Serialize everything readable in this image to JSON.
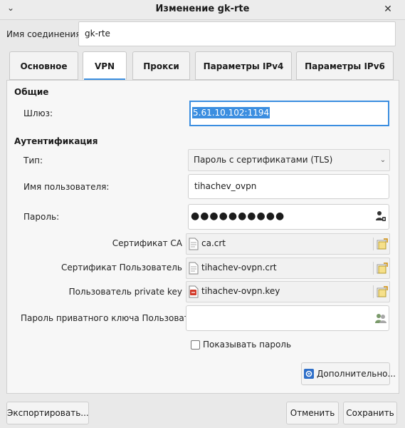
{
  "window": {
    "title": "Изменение gk-rte",
    "chevron_icon": "chevron-down",
    "close_icon": "close"
  },
  "connection": {
    "name_label": "Имя соединения",
    "name_value": "gk-rte"
  },
  "tabs": [
    {
      "label": "Основное",
      "active": false
    },
    {
      "label": "VPN",
      "active": true
    },
    {
      "label": "Прокси",
      "active": false
    },
    {
      "label": "Параметры IPv4",
      "active": false
    },
    {
      "label": "Параметры IPv6",
      "active": false
    }
  ],
  "general": {
    "section_title": "Общие",
    "gateway_label": "Шлюз:",
    "gateway_value": "5.61.10.102:1194"
  },
  "auth": {
    "section_title": "Аутентификация",
    "type_label": "Тип:",
    "type_value": "Пароль с сертификатами (TLS)",
    "username_label": "Имя пользователя:",
    "username_value": "tihachev_ovpn",
    "password_label": "Пароль:",
    "password_value": "●●●●●●●●●●",
    "ca_label": "Сертификат CA",
    "ca_value": "ca.crt",
    "user_cert_label": "Сертификат Пользователь",
    "user_cert_value": "tihachev-ovpn.crt",
    "private_key_label": "Пользователь private key",
    "private_key_value": "tihachev-ovpn.key",
    "key_password_label": "Пароль приватного ключа Пользователь",
    "key_password_value": "",
    "show_password_label": "Показывать пароль",
    "show_password_checked": false
  },
  "buttons": {
    "advanced": "Дополнительно...",
    "export": "Экспортировать...",
    "cancel": "Отменить",
    "save": "Сохранить"
  },
  "colors": {
    "accent": "#3b8ee0",
    "background": "#e9e9e9",
    "panel": "#f7f7f7"
  }
}
